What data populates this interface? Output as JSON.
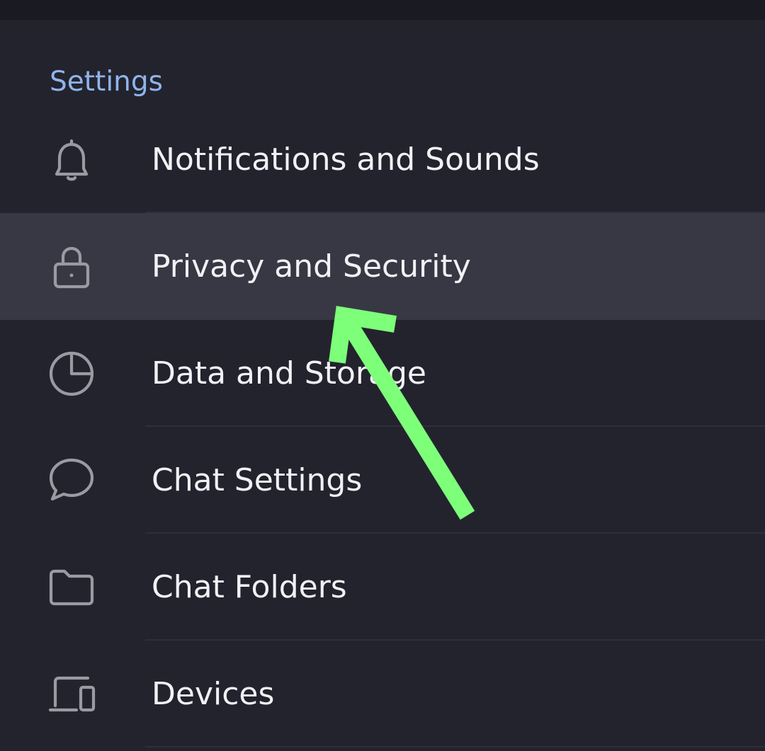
{
  "header": {
    "title": "Settings"
  },
  "items": [
    {
      "label": "Notifications and Sounds",
      "icon": "bell-icon"
    },
    {
      "label": "Privacy and Security",
      "icon": "lock-icon",
      "highlighted": true
    },
    {
      "label": "Data and Storage",
      "icon": "pie-chart-icon"
    },
    {
      "label": "Chat Settings",
      "icon": "chat-bubble-icon"
    },
    {
      "label": "Chat Folders",
      "icon": "folder-icon"
    },
    {
      "label": "Devices",
      "icon": "devices-icon"
    }
  ],
  "annotation": {
    "icon": "arrow-annotation-icon",
    "color": "#7dff7a"
  },
  "colors": {
    "background": "#23232e",
    "highlight": "#383844",
    "header_accent": "#8fb4ea",
    "icon": "#9a9aa3",
    "text": "#f1f1f5"
  }
}
